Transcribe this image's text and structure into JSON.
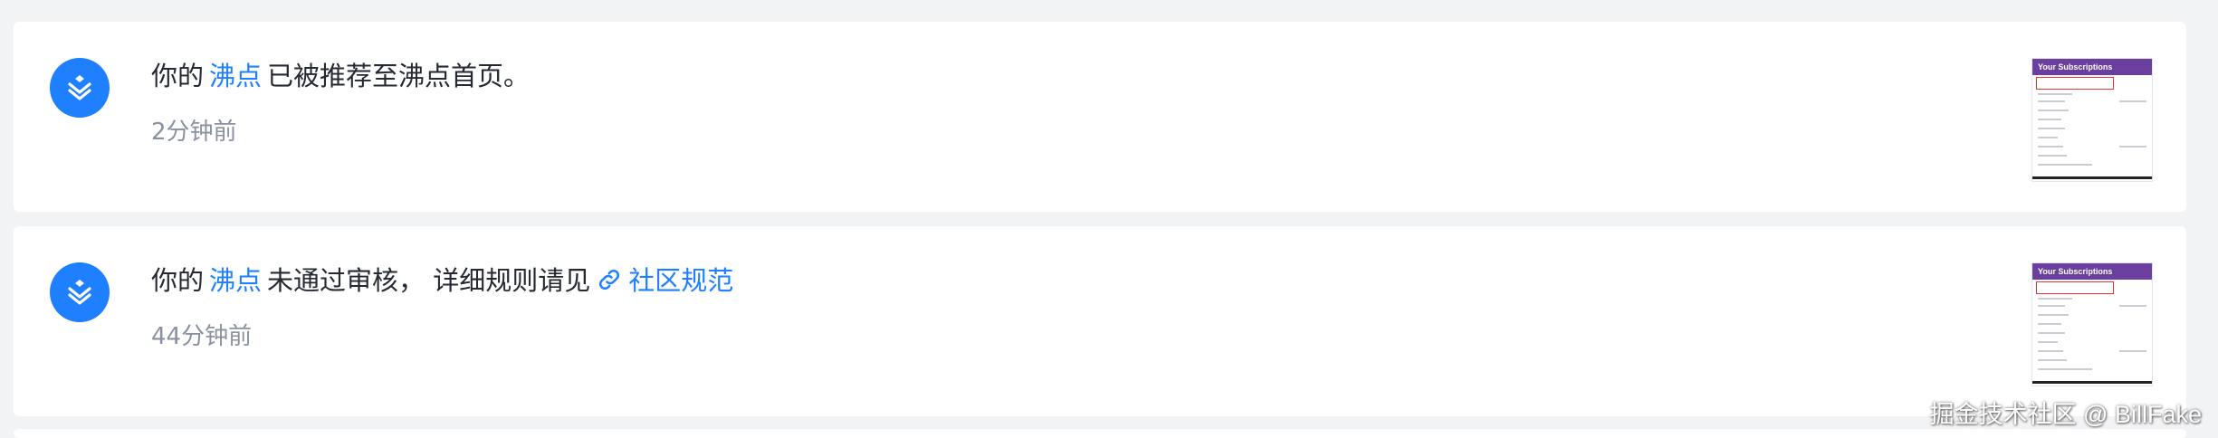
{
  "notifications": [
    {
      "prefix": "你的",
      "link": "沸点",
      "text": "已被推荐至沸点首页。",
      "time": "2分钟前",
      "thumb_title": "Your Subscriptions"
    },
    {
      "prefix": "你的",
      "link": "沸点",
      "text": "未通过审核， 详细规则请见",
      "rule_link": "社区规范",
      "time": "44分钟前",
      "thumb_title": "Your Subscriptions"
    }
  ],
  "watermark": "掘金技术社区 @ BillFake",
  "colors": {
    "accent": "#1e80ff",
    "text": "#252933",
    "muted": "#8a919f",
    "page_bg": "#f2f3f5"
  },
  "icons": {
    "avatar": "juejin-logo-icon",
    "rule_link": "link-icon"
  }
}
